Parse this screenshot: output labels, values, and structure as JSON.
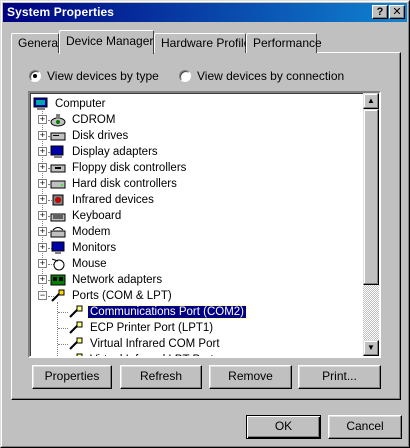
{
  "window": {
    "title": "System Properties",
    "help_btn": "?",
    "close_btn": "✕"
  },
  "tabs": [
    {
      "label": "General"
    },
    {
      "label": "Device Manager"
    },
    {
      "label": "Hardware Profiles"
    },
    {
      "label": "Performance"
    }
  ],
  "view": {
    "by_type": "View devices by type",
    "by_connection": "View devices by connection"
  },
  "tree": {
    "root": "Computer",
    "items": [
      {
        "label": "CDROM",
        "icon": "cdrom-icon"
      },
      {
        "label": "Disk drives",
        "icon": "disk-drive-icon"
      },
      {
        "label": "Display adapters",
        "icon": "display-adapter-icon"
      },
      {
        "label": "Floppy disk controllers",
        "icon": "floppy-controller-icon"
      },
      {
        "label": "Hard disk controllers",
        "icon": "hard-disk-controller-icon"
      },
      {
        "label": "Infrared devices",
        "icon": "infrared-icon"
      },
      {
        "label": "Keyboard",
        "icon": "keyboard-icon"
      },
      {
        "label": "Modem",
        "icon": "modem-icon"
      },
      {
        "label": "Monitors",
        "icon": "monitor-icon"
      },
      {
        "label": "Mouse",
        "icon": "mouse-icon"
      },
      {
        "label": "Network adapters",
        "icon": "network-adapter-icon"
      },
      {
        "label": "Ports (COM & LPT)",
        "icon": "port-icon"
      }
    ],
    "children": [
      {
        "label": "Communications Port (COM2)",
        "selected": true
      },
      {
        "label": "ECP Printer Port (LPT1)"
      },
      {
        "label": "Virtual Infrared COM Port"
      },
      {
        "label": "Virtual Infrared LPT Port"
      }
    ]
  },
  "buttons": {
    "properties": "Properties",
    "refresh": "Refresh",
    "remove": "Remove",
    "print": "Print...",
    "ok": "OK",
    "cancel": "Cancel"
  },
  "colors": {
    "title_start": "#000080",
    "title_end": "#1084d0",
    "selection": "#000080",
    "face": "#c0c0c0"
  }
}
